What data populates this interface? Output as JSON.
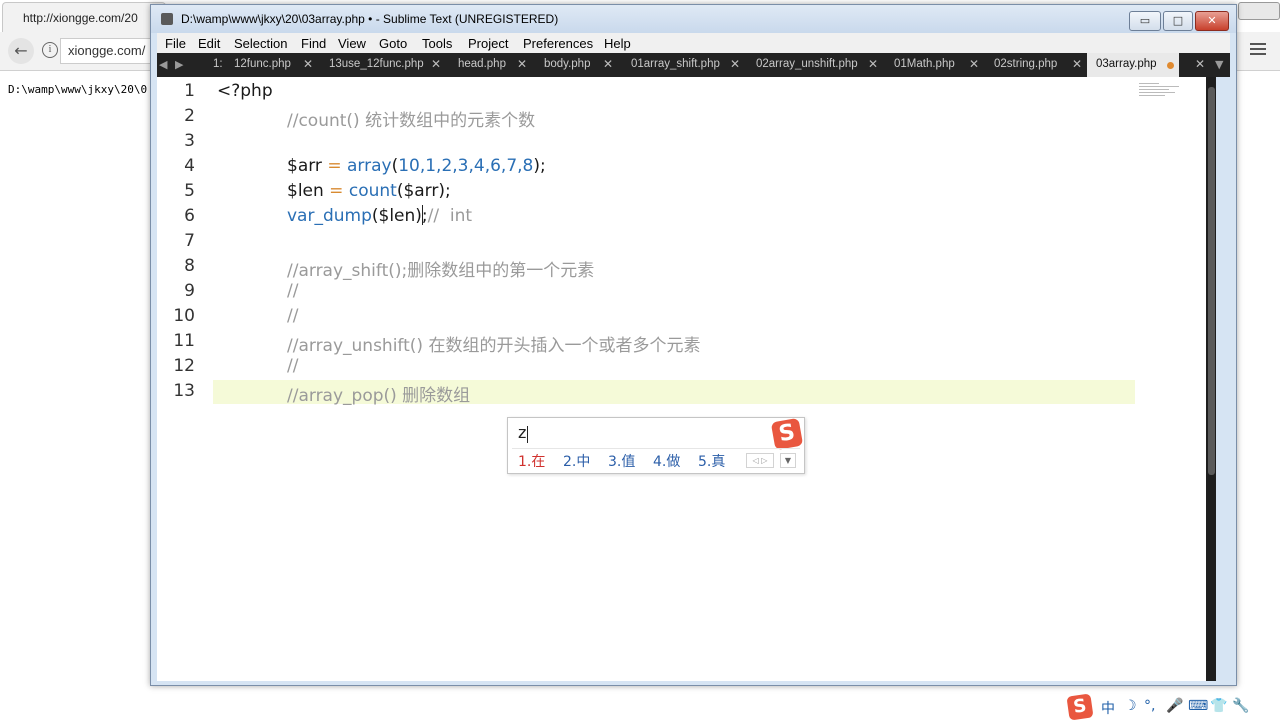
{
  "browser": {
    "tab_title": "http://xiongge.com/20",
    "address": "xiongge.com/",
    "page_text": "D:\\wamp\\www\\jkxy\\20\\0"
  },
  "window": {
    "title": "D:\\wamp\\www\\jkxy\\20\\03array.php • - Sublime Text (UNREGISTERED)",
    "minimize_symbol": "▭",
    "maximize_symbol": "□",
    "close_symbol": "✕"
  },
  "menu": [
    "File",
    "Edit",
    "Selection",
    "Find",
    "View",
    "Goto",
    "Tools",
    "Project",
    "Preferences",
    "Help"
  ],
  "tabs": [
    {
      "label": "1:",
      "close": ""
    },
    {
      "label": "12func.php",
      "close": "✕"
    },
    {
      "label": "13use_12func.php",
      "close": "✕"
    },
    {
      "label": "head.php",
      "close": "✕"
    },
    {
      "label": "body.php",
      "close": "✕"
    },
    {
      "label": "01array_shift.php",
      "close": "✕"
    },
    {
      "label": "02array_unshift.php",
      "close": "✕"
    },
    {
      "label": "01Math.php",
      "close": "✕"
    },
    {
      "label": "02string.php",
      "close": "✕"
    },
    {
      "label": "03array.php",
      "close": ""
    }
  ],
  "tab_nav": {
    "left": "◀",
    "right": "▶",
    "overflow": "▼",
    "edge_close": "✕"
  },
  "editor": {
    "line_numbers": [
      "1",
      "2",
      "3",
      "4",
      "5",
      "6",
      "7",
      "8",
      "9",
      "10",
      "11",
      "12",
      "13"
    ],
    "lines": {
      "l1": "<?php",
      "l2": "//count() 统计数组中的元素个数",
      "l4_var": "$arr",
      "l4_op": " = ",
      "l4_fn": "array",
      "l4_paren": "(",
      "l4_nums": "10,1,2,3,4,6,7,8",
      "l4_end": ");",
      "l5_var": "$len",
      "l5_op": " = ",
      "l5_fn": "count",
      "l5_rest": "($arr);",
      "l6_fn": "var_dump",
      "l6_rest": "($len);",
      "l6_comment": "//  int",
      "l8": "//array_shift();删除数组中的第一个元素",
      "l9": "//",
      "l10": "//",
      "l11": "//array_unshift() 在数组的开头插入一个或者多个元素",
      "l12": "//",
      "l13": "//array_pop() 删除数组"
    }
  },
  "ime": {
    "input": "z",
    "logo": "S",
    "candidates": [
      "1.在",
      "2.中",
      "3.值",
      "4.做",
      "5.真"
    ],
    "pager": "◁ ▷",
    "more": "▼"
  },
  "tray": {
    "logo": "S",
    "items": [
      "中",
      "☽",
      "°,",
      "🎤",
      "⌨",
      "👕",
      "🔧"
    ]
  }
}
